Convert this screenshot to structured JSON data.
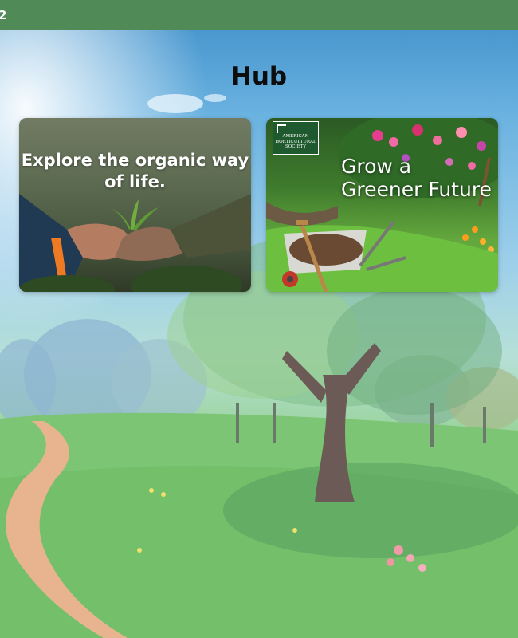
{
  "topbar": {
    "label": "2"
  },
  "page": {
    "title": "Hub"
  },
  "cards": [
    {
      "headline": "Explore the organic way of life."
    },
    {
      "headline": "Grow a Greener Future",
      "logo_text": "AMERICAN HORTICULTURAL SOCIETY"
    }
  ],
  "colors": {
    "topbar": "#4f8a57",
    "title": "#0d0d0d",
    "card_text": "#ffffff"
  }
}
